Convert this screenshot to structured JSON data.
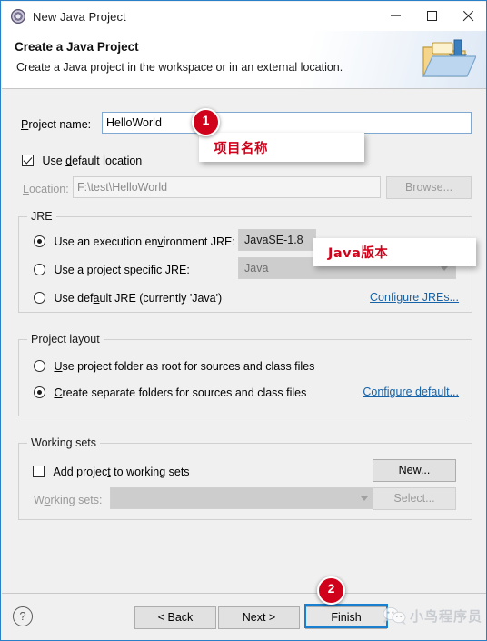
{
  "window": {
    "title": "New Java Project",
    "icon": "eclipse-wizard-icon",
    "controls": {
      "minimize": "minimize",
      "maximize": "maximize",
      "close": "close"
    }
  },
  "header": {
    "title": "Create a Java Project",
    "subtitle": "Create a Java project in the workspace or in an external location.",
    "icon": "new-java-project-folder-icon"
  },
  "form": {
    "project_name_label": "Project name:",
    "project_name_mnemonic": "P",
    "project_name_value": "HelloWorld",
    "project_name_placeholder": "",
    "use_default_location_label": "Use default location",
    "use_default_location_checked": true,
    "location_label": "Location:",
    "location_value": "F:\\test\\HelloWorld",
    "browse_label": "Browse...",
    "browse_enabled": false
  },
  "jre": {
    "group_title": "JRE",
    "options": [
      {
        "label": "Use an execution environment JRE:",
        "selected": true
      },
      {
        "label": "Use a project specific JRE:",
        "selected": false
      },
      {
        "label": "Use default JRE (currently 'Java')",
        "selected": false
      }
    ],
    "execution_env_value": "JavaSE-1.8",
    "specific_jre_value": "Java",
    "configure_link": "Configure JREs..."
  },
  "project_layout": {
    "group_title": "Project layout",
    "options": [
      {
        "label": "Use project folder as root for sources and class files",
        "selected": false
      },
      {
        "label": "Create separate folders for sources and class files",
        "selected": true
      }
    ],
    "configure_link": "Configure default..."
  },
  "working_sets": {
    "group_title": "Working sets",
    "add_label": "Add project to working sets",
    "add_checked": false,
    "new_label": "New...",
    "working_sets_label": "Working sets:",
    "working_sets_value": "",
    "select_label": "Select...",
    "select_enabled": false
  },
  "footer": {
    "help_icon": "question-mark-icon",
    "back_label": "< Back",
    "next_label": "Next >",
    "finish_label": "Finish"
  },
  "annotations": {
    "badge1": "1",
    "callout1": "项目名称",
    "badge2": "2",
    "callout2": "Java版本",
    "accent_color": "#d0021b",
    "highlight_color": "#1b7fd0"
  },
  "watermark": {
    "text": "小鸟程序员",
    "icon": "wechat-icon"
  }
}
